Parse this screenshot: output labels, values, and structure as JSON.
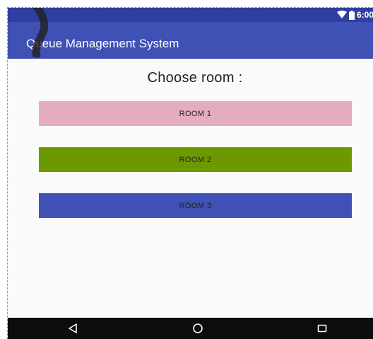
{
  "status_bar": {
    "time": "6:00",
    "icons": [
      "wifi-icon",
      "battery-icon"
    ]
  },
  "app_bar": {
    "title": "Queue Management System"
  },
  "main": {
    "heading": "Choose room :",
    "rooms": [
      {
        "label": "ROOM 1",
        "color": "#e3adbd"
      },
      {
        "label": "ROOM 2",
        "color": "#6a9a00"
      },
      {
        "label": "ROOM 3",
        "color": "#3f51b5"
      }
    ]
  },
  "nav_bar": {
    "icons": [
      "back-icon",
      "home-icon",
      "recents-icon"
    ]
  },
  "colors": {
    "status_bar": "#303f9f",
    "app_bar": "#3f51b5",
    "background": "#fafafa",
    "nav_bar": "#0d0d0d"
  }
}
